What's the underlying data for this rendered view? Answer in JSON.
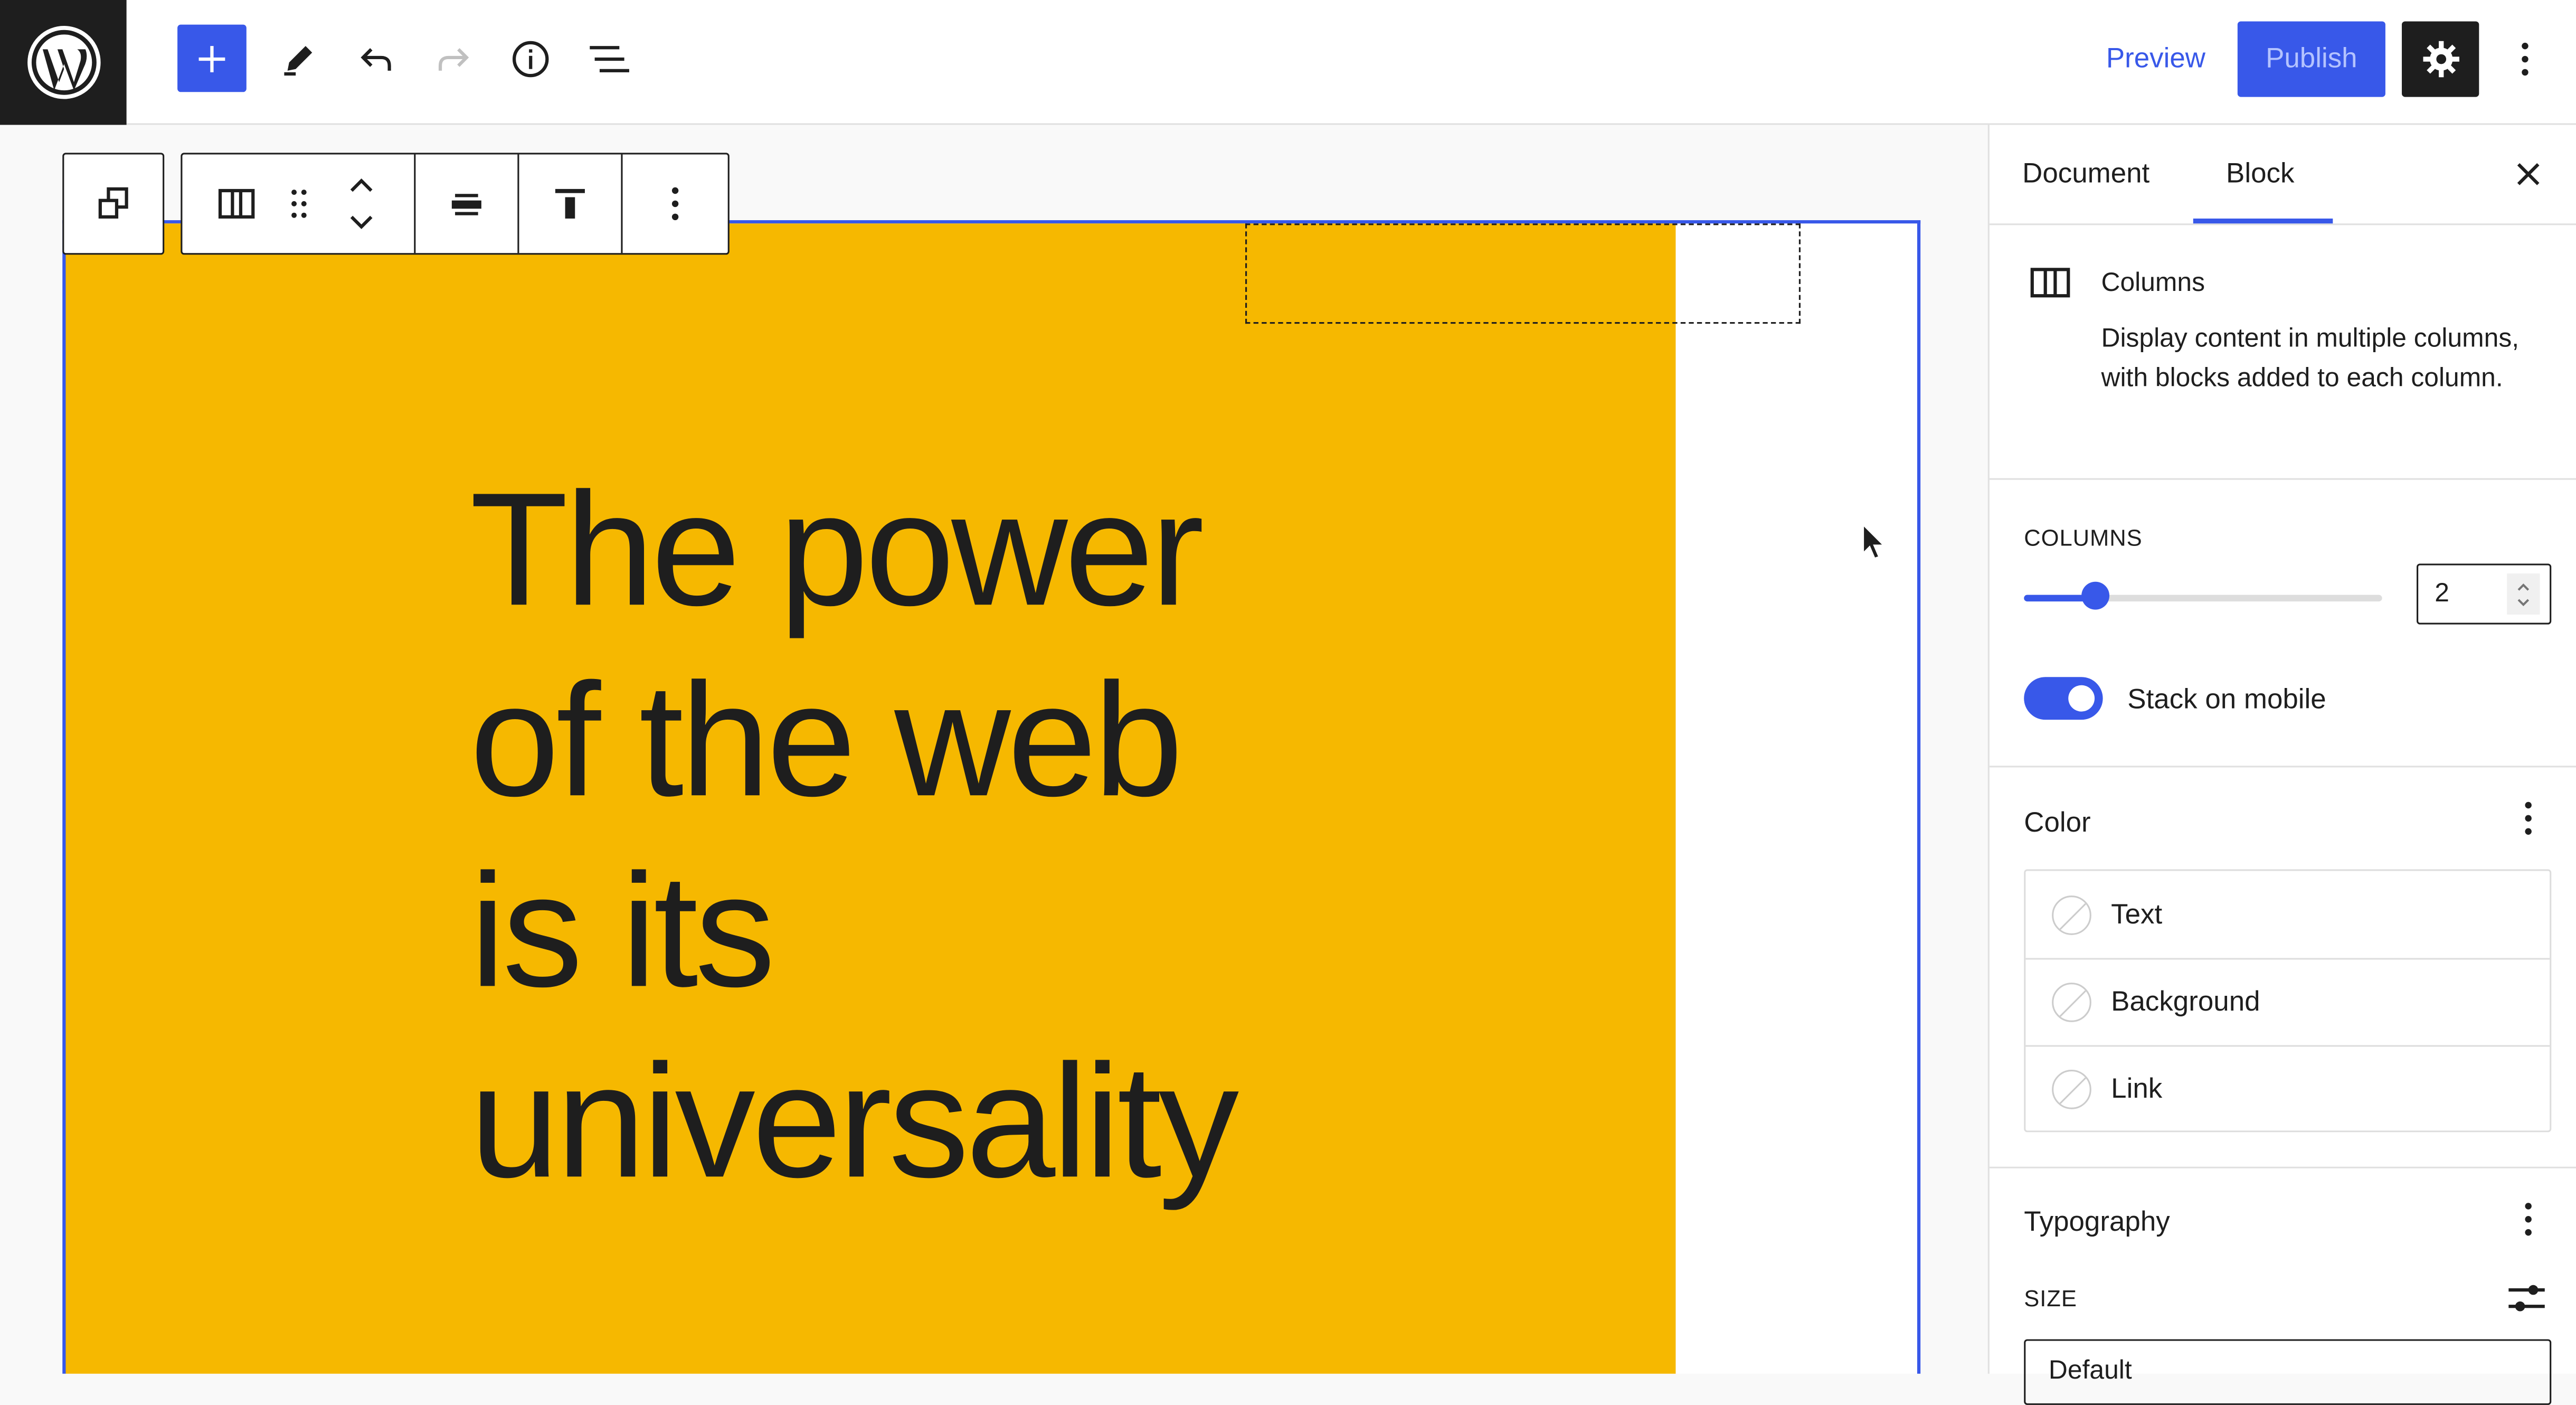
{
  "header": {
    "preview_label": "Preview",
    "publish_label": "Publish"
  },
  "canvas": {
    "heading_text": "The power\nof the web\nis its\nuniversality",
    "column_background": "#f6b800"
  },
  "sidebar": {
    "tabs": [
      {
        "label": "Document"
      },
      {
        "label": "Block"
      }
    ],
    "active_tab": "Block",
    "block_card": {
      "title": "Columns",
      "description": "Display content in multiple columns, with blocks added to each column."
    },
    "columns_panel": {
      "label": "COLUMNS",
      "value": "2",
      "slider_value": 2,
      "stack_label": "Stack on mobile",
      "stack_enabled": true
    },
    "color_panel": {
      "title": "Color",
      "items": [
        {
          "label": "Text"
        },
        {
          "label": "Background"
        },
        {
          "label": "Link"
        }
      ]
    },
    "typography_panel": {
      "title": "Typography",
      "size_label": "SIZE",
      "size_value": "Default"
    }
  },
  "colors": {
    "accent": "#3858e9",
    "dark": "#1e1e1e"
  },
  "icons": {
    "logo": "wordpress-logo-icon",
    "inserter": "plus-icon",
    "tools": "pencil-icon",
    "undo": "undo-icon",
    "redo": "redo-icon",
    "details": "info-icon",
    "list_view": "list-view-icon",
    "settings": "gear-icon",
    "options": "more-vertical-icon"
  }
}
